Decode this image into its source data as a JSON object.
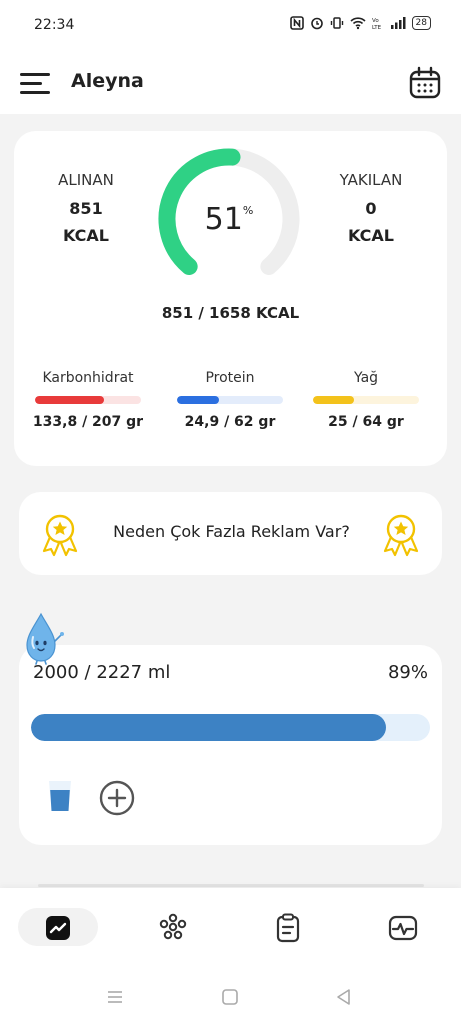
{
  "status_bar": {
    "time": "22:34",
    "battery": "28"
  },
  "header": {
    "title": "Aleyna"
  },
  "summary": {
    "intake_label": "ALINAN",
    "intake_value": "851",
    "intake_unit": "KCAL",
    "burned_label": "YAKILAN",
    "burned_value": "0",
    "burned_unit": "KCAL",
    "progress_percent": 51,
    "percent_number": "51",
    "percent_sign": "%",
    "total": "851 / 1658 KCAL",
    "progress_color": "#2fd185",
    "track_color": "#eeeeee"
  },
  "macros": [
    {
      "label": "Karbonhidrat",
      "value": "133,8 / 207 gr",
      "fraction": 0.65,
      "color": "#e83a3a",
      "track": "#fbe3e3"
    },
    {
      "label": "Protein",
      "value": "24,9 / 62 gr",
      "fraction": 0.4,
      "color": "#2b6fe0",
      "track": "#e3ecfb"
    },
    {
      "label": "Yağ",
      "value": "25 / 64 gr",
      "fraction": 0.39,
      "color": "#f3c21b",
      "track": "#fdf4dd"
    }
  ],
  "ad_banner": {
    "text": "Neden Çok Fazla Reklam Var?",
    "badge_color": "#f2c200"
  },
  "water": {
    "amount": "2000 / 2227 ml",
    "percent_text": "89%",
    "fraction": 0.89,
    "fill_color": "#3d82c4",
    "track_color": "#e4f0fb"
  },
  "bottom_nav": {
    "items": [
      "dashboard-icon",
      "community-icon",
      "clipboard-icon",
      "health-monitor-icon"
    ]
  }
}
